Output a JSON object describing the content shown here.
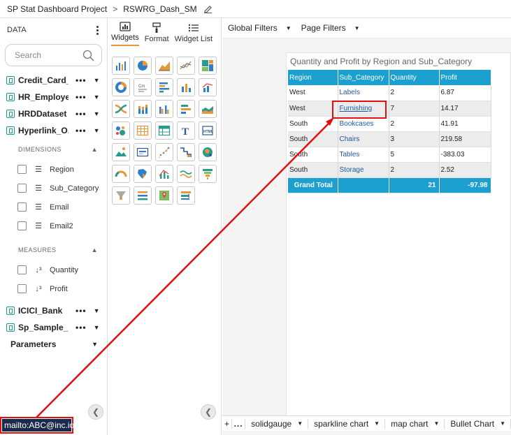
{
  "breadcrumb": {
    "project": "SP Stat Dashboard Project",
    "separator": ">",
    "dashboard": "RSWRG_Dash_SM"
  },
  "data_panel": {
    "title": "DATA",
    "search_placeholder": "Search",
    "datasets": [
      {
        "name": "Credit_Card_..."
      },
      {
        "name": "HR_Employee"
      },
      {
        "name": "HRDDataset"
      },
      {
        "name": "Hyperlink_O..."
      }
    ],
    "dimensions_title": "DIMENSIONS",
    "dimensions": [
      "Region",
      "Sub_Category",
      "Email",
      "Email2"
    ],
    "measures_title": "MEASURES",
    "measures": [
      "Quantity",
      "Profit"
    ],
    "more_datasets": [
      {
        "name": "ICICI_Bank"
      },
      {
        "name": "Sp_Sample_..."
      }
    ],
    "parameters_label": "Parameters"
  },
  "widget_panel": {
    "tabs": [
      "Widgets",
      "Format",
      "Widget List"
    ],
    "active_tab": "Widgets",
    "accent_color": "#e8963a"
  },
  "filters": {
    "global": "Global Filters",
    "page": "Page Filters"
  },
  "table_widget": {
    "title": "Quantity and Profit by Region and Sub_Category",
    "headers": [
      "Region",
      "Sub_Category",
      "Quantity",
      "Profit"
    ],
    "rows": [
      [
        "West",
        "Labels",
        "2",
        "6.87"
      ],
      [
        "West",
        "Furnishing",
        "7",
        "14.17"
      ],
      [
        "South",
        "Bookcases",
        "2",
        "41.91"
      ],
      [
        "South",
        "Chairs",
        "3",
        "219.58"
      ],
      [
        "South",
        "Tables",
        "5",
        "-383.03"
      ],
      [
        "South",
        "Storage",
        "2",
        "2.52"
      ]
    ],
    "total": [
      "Grand Total",
      "",
      "21",
      "-97.98"
    ],
    "header_color": "#1ba0cf"
  },
  "sheet_tabs": {
    "add": "+",
    "more": "...",
    "tabs": [
      "solidgauge",
      "sparkline chart",
      "map chart",
      "Bullet Chart"
    ]
  },
  "status_link": "mailto:ABC@inc.io",
  "annotation_color": "#e01010"
}
